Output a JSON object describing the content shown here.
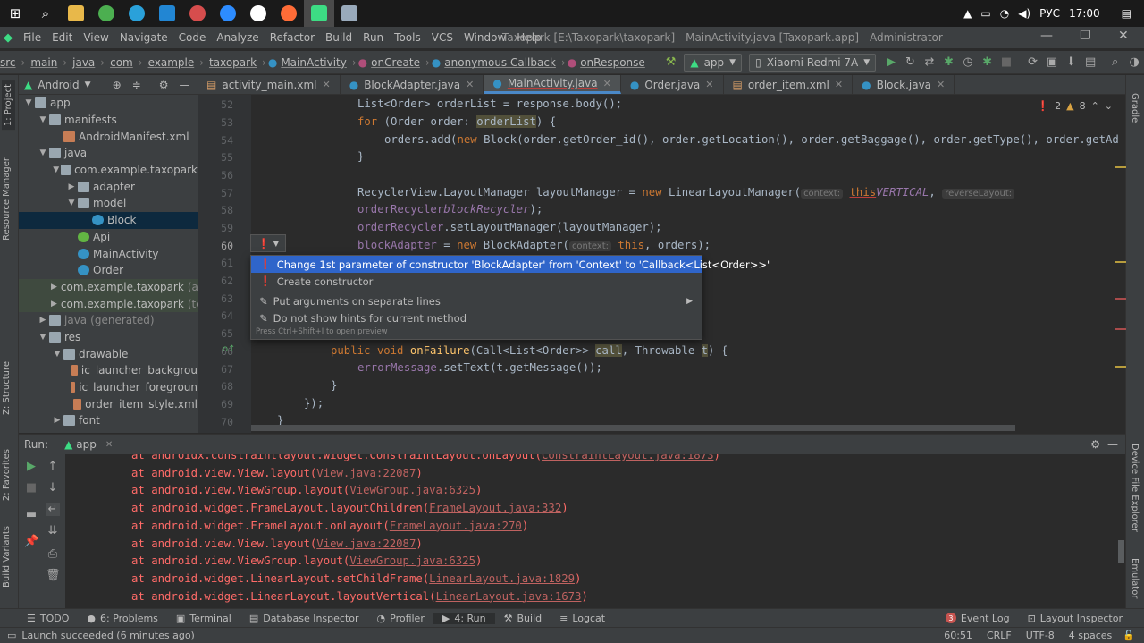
{
  "taskbar": {
    "lang": "РУС",
    "time": "17:00"
  },
  "window": {
    "title": "Taxopark [E:\\Taxopark\\taxopark] - MainActivity.java [Taxopark.app] - Administrator"
  },
  "menu": [
    "File",
    "Edit",
    "View",
    "Navigate",
    "Code",
    "Analyze",
    "Refactor",
    "Build",
    "Run",
    "Tools",
    "VCS",
    "Window",
    "Help"
  ],
  "breadcrumbs": [
    "src",
    "main",
    "java",
    "com",
    "example",
    "taxopark",
    "MainActivity",
    "onCreate",
    "anonymous Callback",
    "onResponse"
  ],
  "run_config": {
    "module": "app",
    "device": "Xiaomi Redmi 7A"
  },
  "left_stripe": {
    "project": "1: Project",
    "resource_manager": "Resource Manager",
    "structure": "Z: Structure",
    "favorites": "2: Favorites",
    "build_variants": "Build Variants"
  },
  "right_stripe": {
    "gradle": "Gradle",
    "device_explorer": "Device File Explorer",
    "emulator": "Emulator"
  },
  "project": {
    "view": "Android",
    "tree": [
      {
        "label": "app",
        "depth": 0,
        "arrow": "▼",
        "icon": "folder"
      },
      {
        "label": "manifests",
        "depth": 1,
        "arrow": "▼",
        "icon": "folder"
      },
      {
        "label": "AndroidManifest.xml",
        "depth": 2,
        "arrow": "",
        "icon": "xml"
      },
      {
        "label": "java",
        "depth": 1,
        "arrow": "▼",
        "icon": "folder"
      },
      {
        "label": "com.example.taxopark",
        "depth": 2,
        "arrow": "▼",
        "icon": "package"
      },
      {
        "label": "adapter",
        "depth": 3,
        "arrow": "▶",
        "icon": "package"
      },
      {
        "label": "model",
        "depth": 3,
        "arrow": "▼",
        "icon": "package"
      },
      {
        "label": "Block",
        "depth": 4,
        "arrow": "",
        "icon": "class"
      },
      {
        "label": "Api",
        "depth": 3,
        "arrow": "",
        "icon": "interface"
      },
      {
        "label": "MainActivity",
        "depth": 3,
        "arrow": "",
        "icon": "class"
      },
      {
        "label": "Order",
        "depth": 3,
        "arrow": "",
        "icon": "class"
      },
      {
        "label": "com.example.taxopark",
        "extra": "(a",
        "depth": 2,
        "arrow": "▶",
        "icon": "package"
      },
      {
        "label": "com.example.taxopark",
        "extra": "(te",
        "depth": 2,
        "arrow": "▶",
        "icon": "package"
      },
      {
        "label": "java",
        "extra": "(generated)",
        "depth": 1,
        "arrow": "▶",
        "icon": "folder"
      },
      {
        "label": "res",
        "depth": 1,
        "arrow": "▼",
        "icon": "folder"
      },
      {
        "label": "drawable",
        "depth": 2,
        "arrow": "▼",
        "icon": "folder"
      },
      {
        "label": "ic_launcher_backgrou",
        "depth": 3,
        "arrow": "",
        "icon": "drawable"
      },
      {
        "label": "ic_launcher_foregroun",
        "depth": 3,
        "arrow": "",
        "icon": "drawable"
      },
      {
        "label": "order_item_style.xml",
        "depth": 3,
        "arrow": "",
        "icon": "drawable"
      },
      {
        "label": "font",
        "depth": 2,
        "arrow": "▶",
        "icon": "folder"
      }
    ]
  },
  "tabs": [
    "activity_main.xml",
    "BlockAdapter.java",
    "MainActivity.java",
    "Order.java",
    "order_item.xml",
    "Block.java"
  ],
  "inspection": {
    "errors": "2",
    "warnings": "8"
  },
  "editor": {
    "lines": [
      "52",
      "53",
      "54",
      "55",
      "56",
      "57",
      "58",
      "59",
      "60",
      "61",
      "62",
      "63",
      "64",
      "65",
      "66",
      "67",
      "68",
      "69",
      "70"
    ],
    "code": {
      "l52": "List<Order> orderList = response.body();",
      "l53a": "for ",
      "l53b": "(Order order: ",
      "l53c": "orderList",
      ") {": ") {",
      "l54a": "orders.add(",
      "l54b": "new ",
      "l54c": "Block(order.getOrder_id(), order.getLocation(), order.getBaggage(), order.getType(), order.getAd",
      "l55": "}",
      "l57a": "RecyclerView.LayoutManager layoutManager = ",
      "l57b": "new ",
      "l57c": "LinearLayoutManager(",
      "l57h": "context:",
      "l57d": "this",
      ", RecyclerView.": ", RecyclerView.",
      "l57e": "VERTICAL",
      ",": ",",
      "l57h2": "reverseLayout:",
      "l58a": "orderRecycler",
      " = findViewById(R.id.": " = findViewById(R.id.",
      "l58b": "blockRecycler",
      "l58c": ");",
      "l59a": "orderRecycler",
      "l59b": ".setLayoutManager(layoutManager);",
      "l60a": "blockAdapter",
      " = ": " = ",
      "l60b": "new ",
      "l60c": "BlockAdapter(",
      "l60h": "context:",
      "l60d": "this",
      "l60e": ", orders);",
      "l66a": "public void ",
      "l66b": "onFailure",
      "l66c": "(Call<List<Order>> ",
      "l66d": "call",
      ", Throwable ": ", Throwable ",
      "l66e": "t",
      "l67a": "errorMessage",
      "l67b": ".setText(t.getMessage());",
      "l68": "}",
      "l69": "});",
      "l70": "}"
    }
  },
  "popup": {
    "items": [
      "Change 1st parameter of constructor 'BlockAdapter' from 'Context' to 'Callback<List<Order>>'",
      "Create constructor",
      "Put arguments on separate lines",
      "Do not show hints for current method"
    ],
    "hint": "Press Ctrl+Shift+I to open preview"
  },
  "run": {
    "label": "Run:",
    "config": "app",
    "lines": [
      {
        "pre": "at androidx.constraintlayout.widget.ConstraintLayout.onLayout(",
        "link": "ConstraintLayout.java:1873",
        "post": ")"
      },
      {
        "pre": "at android.view.View.layout(",
        "link": "View.java:22087",
        "post": ")"
      },
      {
        "pre": "at android.view.ViewGroup.layout(",
        "link": "ViewGroup.java:6325",
        "post": ")"
      },
      {
        "pre": "at android.widget.FrameLayout.layoutChildren(",
        "link": "FrameLayout.java:332",
        "post": ")"
      },
      {
        "pre": "at android.widget.FrameLayout.onLayout(",
        "link": "FrameLayout.java:270",
        "post": ")"
      },
      {
        "pre": "at android.view.View.layout(",
        "link": "View.java:22087",
        "post": ")"
      },
      {
        "pre": "at android.view.ViewGroup.layout(",
        "link": "ViewGroup.java:6325",
        "post": ")"
      },
      {
        "pre": "at android.widget.LinearLayout.setChildFrame(",
        "link": "LinearLayout.java:1829",
        "post": ")"
      },
      {
        "pre": "at android.widget.LinearLayout.layoutVertical(",
        "link": "LinearLayout.java:1673",
        "post": ")"
      }
    ]
  },
  "toolwindows": {
    "todo": "TODO",
    "problems": "6: Problems",
    "terminal": "Terminal",
    "db": "Database Inspector",
    "profiler": "Profiler",
    "run": "4: Run",
    "build": "Build",
    "logcat": "Logcat",
    "events": "Event Log",
    "events_count": "3",
    "layout": "Layout Inspector"
  },
  "status": {
    "message": "Launch succeeded (6 minutes ago)",
    "pos": "60:51",
    "eol": "CRLF",
    "enc": "UTF-8",
    "indent": "4 spaces"
  },
  "colors": {
    "keyword": "#cc7832",
    "field": "#9876aa",
    "method": "#ffc66d",
    "text": "#a9b7c6",
    "error": "#ff6b68",
    "selection": "#2f65ca"
  }
}
